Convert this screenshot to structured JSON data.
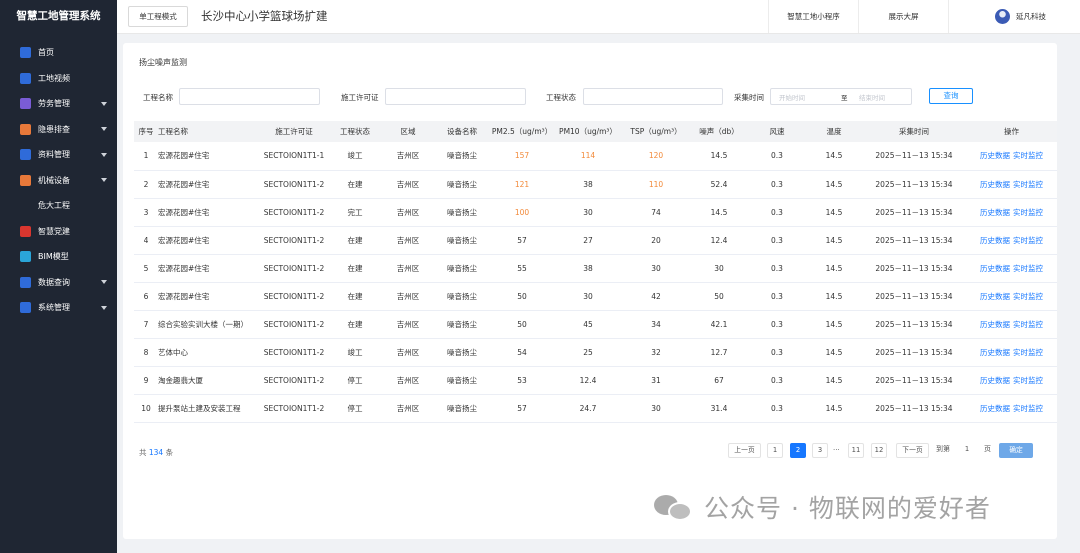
{
  "sidebar": {
    "title": "智慧工地管理系统",
    "items": [
      {
        "label": "首页",
        "icon": "home-icon",
        "color": "#2f6bd9",
        "arrow": false
      },
      {
        "label": "工地视频",
        "icon": "video-icon",
        "color": "#2f6bd9",
        "arrow": false
      },
      {
        "label": "劳务管理",
        "icon": "labor-icon",
        "color": "#7a5cd6",
        "arrow": true
      },
      {
        "label": "隐患排查",
        "icon": "hazard-icon",
        "color": "#e8793a",
        "arrow": true
      },
      {
        "label": "资料管理",
        "icon": "document-icon",
        "color": "#2f6bd9",
        "arrow": true
      },
      {
        "label": "机械设备",
        "icon": "machine-icon",
        "color": "#e8793a",
        "arrow": true
      },
      {
        "label": "危大工程",
        "icon": "",
        "color": "",
        "arrow": false
      },
      {
        "label": "智慧党建",
        "icon": "party-icon",
        "color": "#d9362f",
        "arrow": false
      },
      {
        "label": "BIM模型",
        "icon": "bim-icon",
        "color": "#2aa5d9",
        "arrow": false
      },
      {
        "label": "数据查询",
        "icon": "data-query-icon",
        "color": "#2f6bd9",
        "arrow": true
      },
      {
        "label": "系统管理",
        "icon": "settings-icon",
        "color": "#2f6bd9",
        "arrow": true
      }
    ]
  },
  "header": {
    "mode_button": "单工程模式",
    "project_title": "长沙中心小学篮球场扩建",
    "mini_program": "智慧工地小程序",
    "big_screen": "展示大屏",
    "company": "延凡科技"
  },
  "card": {
    "title": "扬尘噪声监测"
  },
  "filters": {
    "project_name_label": "工程名称",
    "permit_label": "施工许可证",
    "status_label": "工程状态",
    "time_label": "采集时间",
    "start_placeholder": "开始时间",
    "to": "至",
    "end_placeholder": "结束时间",
    "query_button": "查询"
  },
  "table": {
    "headers": [
      "序号",
      "工程名称",
      "施工许可证",
      "工程状态",
      "区域",
      "设备名称",
      "PM2.5（ug/m³）",
      "PM10（ug/m³）",
      "TSP（ug/m³）",
      "噪声（db）",
      "风速",
      "温度",
      "采集时间",
      "操作"
    ],
    "rows": [
      {
        "no": "1",
        "name": "宏源花园#住宅",
        "permit": "SECTOION1T1-1",
        "status": "竣工",
        "area": "吉州区",
        "device": "噪音扬尘",
        "pm25": "157",
        "pm10": "114",
        "tsp": "120",
        "noise": "14.5",
        "wind": "0.3",
        "temp": "14.5",
        "time": "2025－11－13  15:34",
        "pm25_warn": true,
        "pm10_warn": true,
        "tsp_warn": true
      },
      {
        "no": "2",
        "name": "宏源花园#住宅",
        "permit": "SECTOION1T1-2",
        "status": "在建",
        "area": "吉州区",
        "device": "噪音扬尘",
        "pm25": "121",
        "pm10": "38",
        "tsp": "110",
        "noise": "52.4",
        "wind": "0.3",
        "temp": "14.5",
        "time": "2025－11－13  15:34",
        "pm25_warn": true,
        "pm10_warn": false,
        "tsp_warn": true
      },
      {
        "no": "3",
        "name": "宏源花园#住宅",
        "permit": "SECTOION1T1-2",
        "status": "完工",
        "area": "吉州区",
        "device": "噪音扬尘",
        "pm25": "100",
        "pm10": "30",
        "tsp": "74",
        "noise": "14.5",
        "wind": "0.3",
        "temp": "14.5",
        "time": "2025－11－13  15:34",
        "pm25_warn": true,
        "pm10_warn": false,
        "tsp_warn": false
      },
      {
        "no": "4",
        "name": "宏源花园#住宅",
        "permit": "SECTOION1T1-2",
        "status": "在建",
        "area": "吉州区",
        "device": "噪音扬尘",
        "pm25": "57",
        "pm10": "27",
        "tsp": "20",
        "noise": "12.4",
        "wind": "0.3",
        "temp": "14.5",
        "time": "2025－11－13  15:34",
        "pm25_warn": false,
        "pm10_warn": false,
        "tsp_warn": false
      },
      {
        "no": "5",
        "name": "宏源花园#住宅",
        "permit": "SECTOION1T1-2",
        "status": "在建",
        "area": "吉州区",
        "device": "噪音扬尘",
        "pm25": "55",
        "pm10": "38",
        "tsp": "30",
        "noise": "30",
        "wind": "0.3",
        "temp": "14.5",
        "time": "2025－11－13  15:34",
        "pm25_warn": false,
        "pm10_warn": false,
        "tsp_warn": false
      },
      {
        "no": "6",
        "name": "宏源花园#住宅",
        "permit": "SECTOION1T1-2",
        "status": "在建",
        "area": "吉州区",
        "device": "噪音扬尘",
        "pm25": "50",
        "pm10": "30",
        "tsp": "42",
        "noise": "50",
        "wind": "0.3",
        "temp": "14.5",
        "time": "2025－11－13  15:34",
        "pm25_warn": false,
        "pm10_warn": false,
        "tsp_warn": false
      },
      {
        "no": "7",
        "name": "综合实验实训大楼（一期）",
        "permit": "SECTOION1T1-2",
        "status": "在建",
        "area": "吉州区",
        "device": "噪音扬尘",
        "pm25": "50",
        "pm10": "45",
        "tsp": "34",
        "noise": "42.1",
        "wind": "0.3",
        "temp": "14.5",
        "time": "2025－11－13  15:34",
        "pm25_warn": false,
        "pm10_warn": false,
        "tsp_warn": false
      },
      {
        "no": "8",
        "name": "艺体中心",
        "permit": "SECTOION1T1-2",
        "status": "竣工",
        "area": "吉州区",
        "device": "噪音扬尘",
        "pm25": "54",
        "pm10": "25",
        "tsp": "32",
        "noise": "12.7",
        "wind": "0.3",
        "temp": "14.5",
        "time": "2025－11－13  15:34",
        "pm25_warn": false,
        "pm10_warn": false,
        "tsp_warn": false
      },
      {
        "no": "9",
        "name": "淘金趣翡大厦",
        "permit": "SECTOION1T1-2",
        "status": "停工",
        "area": "吉州区",
        "device": "噪音扬尘",
        "pm25": "53",
        "pm10": "12.4",
        "tsp": "31",
        "noise": "67",
        "wind": "0.3",
        "temp": "14.5",
        "time": "2025－11－13  15:34",
        "pm25_warn": false,
        "pm10_warn": false,
        "tsp_warn": false
      },
      {
        "no": "10",
        "name": "提升泵站土建及安装工程",
        "permit": "SECTOION1T1-2",
        "status": "停工",
        "area": "吉州区",
        "device": "噪音扬尘",
        "pm25": "57",
        "pm10": "24.7",
        "tsp": "30",
        "noise": "31.4",
        "wind": "0.3",
        "temp": "14.5",
        "time": "2025－11－13  15:34",
        "pm25_warn": false,
        "pm10_warn": false,
        "tsp_warn": false
      }
    ],
    "action_history": "历史数据",
    "action_realtime": "实时监控"
  },
  "pagination": {
    "total_prefix": "共",
    "total": "134",
    "total_suffix": "条",
    "prev": "上一页",
    "pages": [
      "1",
      "2",
      "3"
    ],
    "ellipsis": "...",
    "tail_pages": [
      "11",
      "12"
    ],
    "current": "2",
    "next": "下一页",
    "goto_label": "到第",
    "goto_value": "1",
    "page_unit": "页",
    "confirm": "确定"
  },
  "watermark": {
    "text": "公众号 · 物联网的爱好者"
  },
  "colors": {
    "sidebar_bg": "#1f2633",
    "accent": "#1677ff",
    "warn": "#f28a3a"
  }
}
